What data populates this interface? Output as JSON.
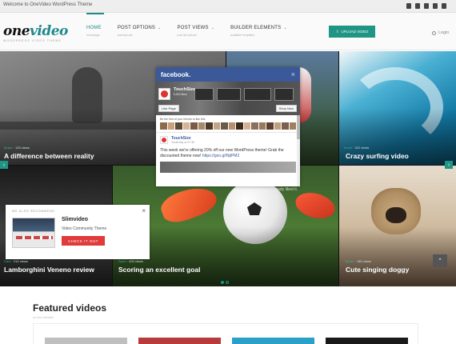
{
  "topbar": {
    "welcome": "Welcome to OneVideo WordPress Theme",
    "social_icons": [
      "facebook-icon",
      "twitter-icon",
      "rss-icon",
      "vimeo-icon",
      "youtube-icon"
    ]
  },
  "header": {
    "logo_main": "one",
    "logo_accent": "video",
    "tagline": "WORDPRESS VIDEO THEME",
    "nav": [
      {
        "label": "HOME",
        "sub": "homepage",
        "active": true,
        "has_menu": false
      },
      {
        "label": "POST OPTIONS",
        "sub": "post layouts",
        "active": false,
        "has_menu": true
      },
      {
        "label": "POST VIEWS",
        "sub": "post list options",
        "active": false,
        "has_menu": true
      },
      {
        "label": "BUILDER ELEMENTS",
        "sub": "available templates",
        "active": false,
        "has_menu": true
      }
    ],
    "upload_label": "UPLOAD VIDEO",
    "login_label": "Login"
  },
  "hero": {
    "tiles": [
      {
        "title": "A difference between reality",
        "meta_cat": "Music",
        "meta_rest": " · 125 views"
      },
      {
        "title": "",
        "meta_cat": "",
        "meta_rest": ""
      },
      {
        "title": "Crazy surfing video",
        "meta_cat": "Travel",
        "meta_rest": " · 312 views"
      },
      {
        "title": "Lamborghini Veneno review",
        "meta_cat": "Cars",
        "meta_rest": " · 210 views"
      },
      {
        "title": "Scoring an excellent goal",
        "meta_cat": "Sport",
        "meta_rest": " · 420 views"
      },
      {
        "title": "Cute singing doggy",
        "meta_cat": "Music",
        "meta_rest": " · 180 views"
      }
    ],
    "prev_arrow": "‹",
    "next_arrow": "›"
  },
  "facebook": {
    "brand": "facebook.",
    "page_name": "TouchSize",
    "likes": "5,523 likes",
    "like_button": "Like Page",
    "shop_button": "Shop Now",
    "friends_text": "Be the first of your friends to like this",
    "friend_colors": [
      "#8b6b4a",
      "#c9a07a",
      "#5a4a3a",
      "#d8b494",
      "#7a5a42",
      "#a88a6a",
      "#4a3a2a",
      "#c4a484",
      "#6a5a4a",
      "#b89070",
      "#3a2a1a",
      "#d4b090",
      "#8a7060",
      "#9a7a5a",
      "#5a4030",
      "#c0a080",
      "#7a6050",
      "#a08060"
    ],
    "post_author": "TouchSize",
    "post_date": "Yesterday at 07:36",
    "post_text": "This week we're offering 20% off our new WordPress theme! Grab the discounted theme now!",
    "post_link": "https://goo.gl/NjtPM2",
    "close_symbol": "×"
  },
  "already_liked": "I already liked it.",
  "promo": {
    "heading": "WE ALSO RECOMMEND",
    "name": "Slimvideo",
    "description": "Video Community Theme",
    "button": "CHECK IT OUT",
    "close_symbol": "×"
  },
  "scroll_top": "⌃",
  "slider_dots": [
    true,
    false
  ],
  "featured": {
    "title": "Featured videos",
    "subtitle": "on the website",
    "thumb_colors": [
      "#bfbfbf",
      "#b83a3a",
      "#2aa0c8",
      "#1a1a1a"
    ]
  },
  "colors": {
    "accent": "#1f8a8a",
    "button_teal": "#1f9584",
    "facebook_blue": "#3b5998",
    "promo_red": "#e03a3a"
  }
}
